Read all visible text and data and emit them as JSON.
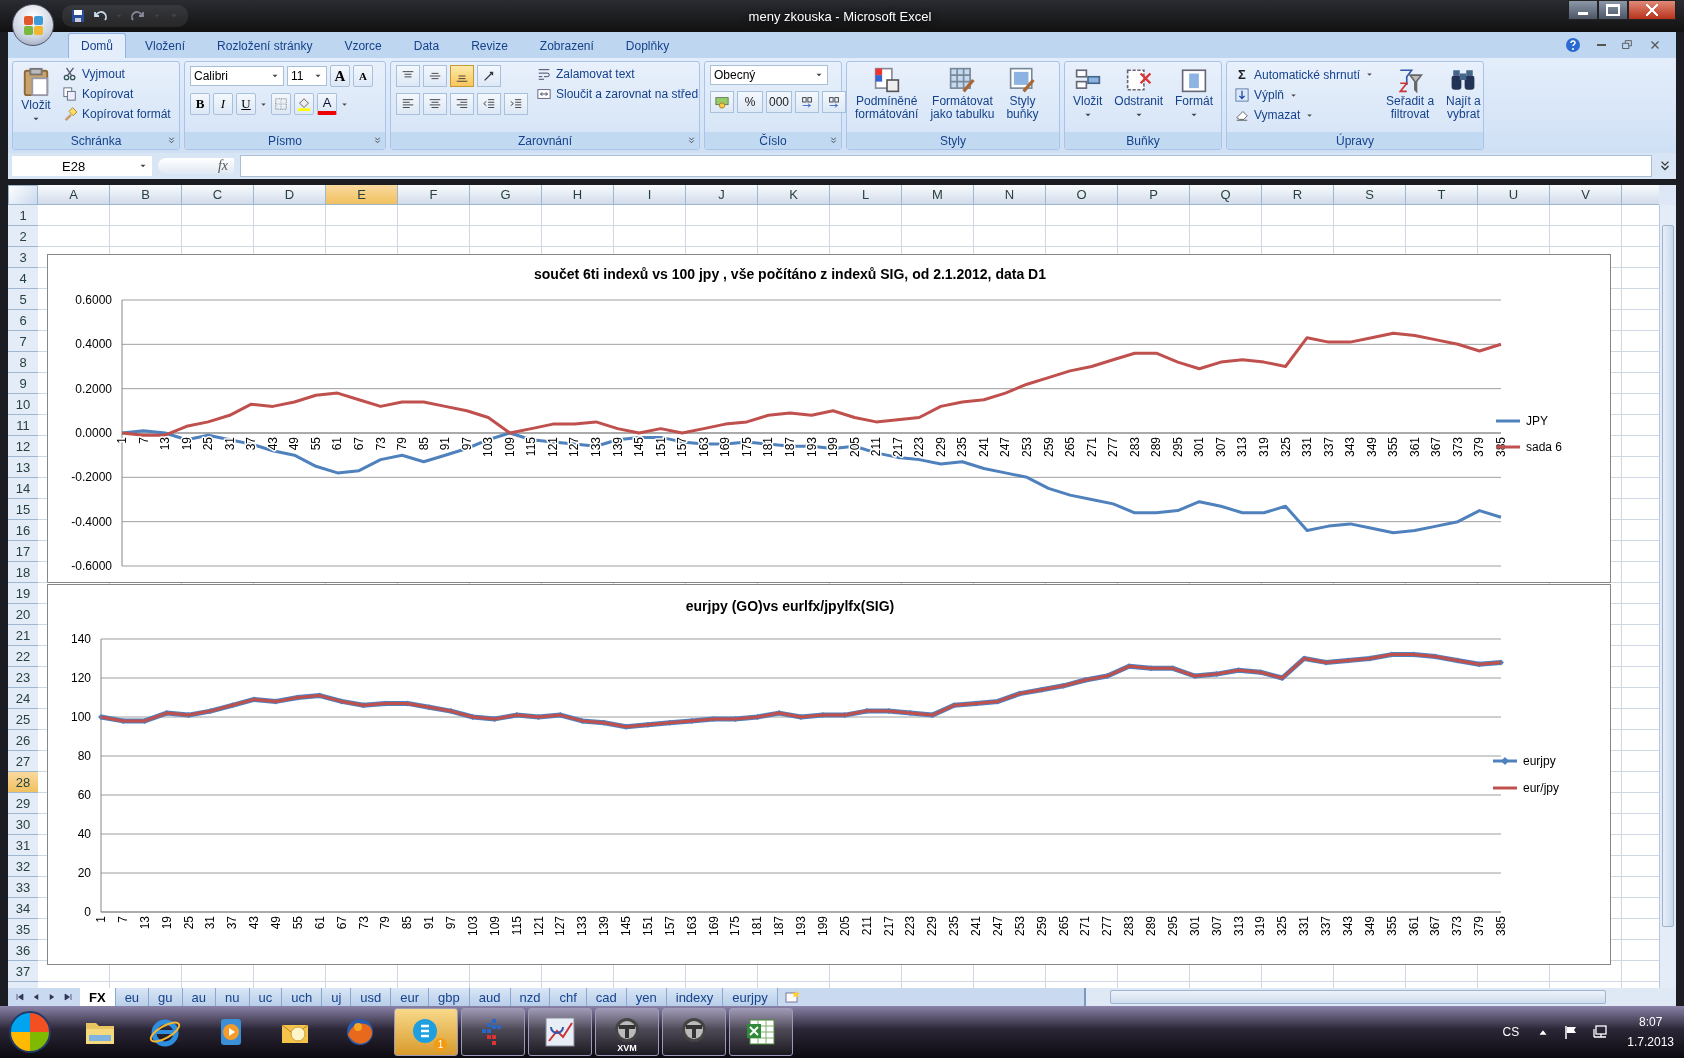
{
  "window": {
    "title": "meny zkouska  -  Microsoft Excel"
  },
  "ribbon_tabs": [
    {
      "label": "Domů",
      "selected": true
    },
    {
      "label": "Vložení",
      "selected": false
    },
    {
      "label": "Rozložení stránky",
      "selected": false
    },
    {
      "label": "Vzorce",
      "selected": false
    },
    {
      "label": "Data",
      "selected": false
    },
    {
      "label": "Revize",
      "selected": false
    },
    {
      "label": "Zobrazení",
      "selected": false
    },
    {
      "label": "Doplňky",
      "selected": false
    }
  ],
  "clipboard": {
    "label": "Schránka",
    "paste": "Vložit",
    "actions": [
      "Vyjmout",
      "Kopírovat",
      "Kopírovat formát"
    ]
  },
  "font": {
    "label": "Písmo",
    "name": "Calibri",
    "size": "11",
    "grow": "A",
    "shrink": "A",
    "styles": [
      "B",
      "I",
      "U"
    ],
    "color_button": "A"
  },
  "alignment": {
    "label": "Zarovnání",
    "vertical": [
      {
        "selected": false
      },
      {
        "selected": false
      },
      {
        "selected": true
      }
    ],
    "wrap": "Zalamovat text",
    "merge": "Sloučit a zarovnat na střed"
  },
  "number": {
    "label": "Číslo",
    "format": "Obecný",
    "percent": "%",
    "thousands": "000"
  },
  "styles": {
    "label": "Styly",
    "buttons": [
      "Podmíněné\nformátování",
      "Formátovat\njako tabulku",
      "Styly\nbuňky"
    ]
  },
  "cells": {
    "label": "Buňky",
    "buttons": [
      "Vložit",
      "Odstranit",
      "Formát"
    ]
  },
  "editing": {
    "label": "Úpravy",
    "sum_symbol": "Σ",
    "actions": [
      "Automatické shrnutí",
      "Výplň",
      "Vymazat"
    ],
    "buttons": [
      "Seřadit a\nfiltrovat",
      "Najít a\nvybrat"
    ]
  },
  "formula_bar": {
    "name_box": "E28",
    "fx": "fx"
  },
  "columns": [
    {
      "label": "A",
      "selected": false
    },
    {
      "label": "B",
      "selected": false
    },
    {
      "label": "C",
      "selected": false
    },
    {
      "label": "D",
      "selected": false
    },
    {
      "label": "E",
      "selected": true
    },
    {
      "label": "F",
      "selected": false
    },
    {
      "label": "G",
      "selected": false
    },
    {
      "label": "H",
      "selected": false
    },
    {
      "label": "I",
      "selected": false
    },
    {
      "label": "J",
      "selected": false
    },
    {
      "label": "K",
      "selected": false
    },
    {
      "label": "L",
      "selected": false
    },
    {
      "label": "M",
      "selected": false
    },
    {
      "label": "N",
      "selected": false
    },
    {
      "label": "O",
      "selected": false
    },
    {
      "label": "P",
      "selected": false
    },
    {
      "label": "Q",
      "selected": false
    },
    {
      "label": "R",
      "selected": false
    },
    {
      "label": "S",
      "selected": false
    },
    {
      "label": "T",
      "selected": false
    },
    {
      "label": "U",
      "selected": false
    },
    {
      "label": "V",
      "selected": false
    }
  ],
  "rows": [
    {
      "label": "1",
      "selected": false
    },
    {
      "label": "2",
      "selected": false
    },
    {
      "label": "3",
      "selected": false
    },
    {
      "label": "4",
      "selected": false
    },
    {
      "label": "5",
      "selected": false
    },
    {
      "label": "6",
      "selected": false
    },
    {
      "label": "7",
      "selected": false
    },
    {
      "label": "8",
      "selected": false
    },
    {
      "label": "9",
      "selected": false
    },
    {
      "label": "10",
      "selected": false
    },
    {
      "label": "11",
      "selected": false
    },
    {
      "label": "12",
      "selected": false
    },
    {
      "label": "13",
      "selected": false
    },
    {
      "label": "14",
      "selected": false
    },
    {
      "label": "15",
      "selected": false
    },
    {
      "label": "16",
      "selected": false
    },
    {
      "label": "17",
      "selected": false
    },
    {
      "label": "18",
      "selected": false
    },
    {
      "label": "19",
      "selected": false
    },
    {
      "label": "20",
      "selected": false
    },
    {
      "label": "21",
      "selected": false
    },
    {
      "label": "22",
      "selected": false
    },
    {
      "label": "23",
      "selected": false
    },
    {
      "label": "24",
      "selected": false
    },
    {
      "label": "25",
      "selected": false
    },
    {
      "label": "26",
      "selected": false
    },
    {
      "label": "27",
      "selected": false
    },
    {
      "label": "28",
      "selected": true
    },
    {
      "label": "29",
      "selected": false
    },
    {
      "label": "30",
      "selected": false
    },
    {
      "label": "31",
      "selected": false
    },
    {
      "label": "32",
      "selected": false
    },
    {
      "label": "33",
      "selected": false
    },
    {
      "label": "34",
      "selected": false
    },
    {
      "label": "35",
      "selected": false
    },
    {
      "label": "36",
      "selected": false
    },
    {
      "label": "37",
      "selected": false
    }
  ],
  "charts": [
    {
      "chart_data": {
        "type": "line",
        "grid": true,
        "legend": "right",
        "title": "součet 6ti indexů vs 100 jpy , vše počítáno z indexů SIG, od 2.1.2012, data D1",
        "categories": [
          "1",
          "7",
          "13",
          "19",
          "25",
          "31",
          "37",
          "43",
          "49",
          "55",
          "61",
          "67",
          "73",
          "79",
          "85",
          "91",
          "97",
          "103",
          "109",
          "115",
          "121",
          "127",
          "133",
          "139",
          "145",
          "151",
          "157",
          "163",
          "169",
          "175",
          "181",
          "187",
          "193",
          "199",
          "205",
          "211",
          "217",
          "223",
          "229",
          "235",
          "241",
          "247",
          "253",
          "259",
          "265",
          "271",
          "277",
          "283",
          "289",
          "295",
          "301",
          "307",
          "313",
          "319",
          "325",
          "331",
          "337",
          "343",
          "349",
          "355",
          "361",
          "367",
          "373",
          "379",
          "385"
        ],
        "ylim": [
          -0.6,
          0.6
        ],
        "yticks": [
          {
            "value": 0.6,
            "label": "0.6000"
          },
          {
            "value": 0.4,
            "label": "0.4000"
          },
          {
            "value": 0.2,
            "label": "0.2000"
          },
          {
            "value": 0,
            "label": "0.0000"
          },
          {
            "value": -0.2,
            "label": "-0.2000"
          },
          {
            "value": -0.4,
            "label": "-0.4000"
          },
          {
            "value": -0.6,
            "label": "-0.6000"
          }
        ],
        "series": [
          {
            "name": "JPY",
            "color": "#4f81bd",
            "values": [
              0,
              0.01,
              0,
              -0.03,
              -0.01,
              -0.03,
              -0.05,
              -0.08,
              -0.1,
              -0.15,
              -0.18,
              -0.17,
              -0.12,
              -0.1,
              -0.13,
              -0.1,
              -0.07,
              -0.03,
              0,
              -0.03,
              -0.04,
              -0.05,
              -0.06,
              -0.03,
              -0.02,
              -0.02,
              -0.04,
              -0.05,
              -0.05,
              -0.04,
              -0.05,
              -0.06,
              -0.06,
              -0.07,
              -0.06,
              -0.09,
              -0.11,
              -0.12,
              -0.14,
              -0.13,
              -0.16,
              -0.18,
              -0.2,
              -0.25,
              -0.28,
              -0.3,
              -0.32,
              -0.36,
              -0.36,
              -0.35,
              -0.31,
              -0.33,
              -0.36,
              -0.36,
              -0.33,
              -0.44,
              -0.42,
              -0.41,
              -0.43,
              -0.45,
              -0.44,
              -0.42,
              -0.4,
              -0.35,
              -0.38
            ]
          },
          {
            "name": "sada 6",
            "color": "#c0504d",
            "values": [
              0,
              -0.01,
              -0.01,
              0.03,
              0.05,
              0.08,
              0.13,
              0.12,
              0.14,
              0.17,
              0.18,
              0.15,
              0.12,
              0.14,
              0.14,
              0.12,
              0.1,
              0.07,
              0,
              0.02,
              0.04,
              0.04,
              0.05,
              0.02,
              0,
              0.02,
              0,
              0.02,
              0.04,
              0.05,
              0.08,
              0.09,
              0.08,
              0.1,
              0.07,
              0.05,
              0.06,
              0.07,
              0.12,
              0.14,
              0.15,
              0.18,
              0.22,
              0.25,
              0.28,
              0.3,
              0.33,
              0.36,
              0.36,
              0.32,
              0.29,
              0.32,
              0.33,
              0.32,
              0.3,
              0.43,
              0.41,
              0.41,
              0.43,
              0.45,
              0.44,
              0.42,
              0.4,
              0.37,
              0.4
            ]
          }
        ]
      }
    },
    {
      "chart_data": {
        "type": "line",
        "grid": true,
        "legend": "right",
        "title": "eurjpy (GO)vs eurlfx/jpylfx(SIG)",
        "categories": [
          "1",
          "7",
          "13",
          "19",
          "25",
          "31",
          "37",
          "43",
          "49",
          "55",
          "61",
          "67",
          "73",
          "79",
          "85",
          "91",
          "97",
          "103",
          "109",
          "115",
          "121",
          "127",
          "133",
          "139",
          "145",
          "151",
          "157",
          "163",
          "169",
          "175",
          "181",
          "187",
          "193",
          "199",
          "205",
          "211",
          "217",
          "223",
          "229",
          "235",
          "241",
          "247",
          "253",
          "259",
          "265",
          "271",
          "277",
          "283",
          "289",
          "295",
          "301",
          "307",
          "313",
          "319",
          "325",
          "331",
          "337",
          "343",
          "349",
          "355",
          "361",
          "367",
          "373",
          "379",
          "385"
        ],
        "ylim": [
          0,
          140
        ],
        "yticks": [
          0,
          20,
          40,
          60,
          80,
          100,
          120,
          140
        ],
        "series": [
          {
            "name": "eurjpy",
            "color": "#4f81bd",
            "marker": "diamond",
            "values": [
              100,
              98,
              98,
              102,
              101,
              103,
              106,
              109,
              108,
              110,
              111,
              108,
              106,
              107,
              107,
              105,
              103,
              100,
              99,
              101,
              100,
              101,
              98,
              97,
              95,
              96,
              97,
              98,
              99,
              99,
              100,
              102,
              100,
              101,
              101,
              103,
              103,
              102,
              101,
              106,
              107,
              108,
              112,
              114,
              116,
              119,
              121,
              126,
              125,
              125,
              121,
              122,
              124,
              123,
              120,
              130,
              128,
              129,
              130,
              132,
              132,
              131,
              129,
              127,
              128
            ]
          },
          {
            "name": "eur/jpy",
            "color": "#c0504d",
            "values": [
              100,
              98,
              98,
              102,
              101,
              103,
              106,
              109,
              108,
              110,
              111,
              108,
              106,
              107,
              107,
              105,
              103,
              100,
              99,
              101,
              100,
              101,
              98,
              97,
              95,
              96,
              97,
              98,
              99,
              99,
              100,
              102,
              100,
              101,
              101,
              103,
              103,
              102,
              101,
              106,
              107,
              108,
              112,
              114,
              116,
              119,
              121,
              126,
              125,
              125,
              121,
              122,
              124,
              123,
              120,
              130,
              128,
              129,
              130,
              132,
              132,
              131,
              129,
              127,
              128
            ]
          }
        ]
      }
    }
  ],
  "sheet_tabs": [
    {
      "label": "FX",
      "selected": true
    },
    {
      "label": "eu",
      "selected": false
    },
    {
      "label": "gu",
      "selected": false
    },
    {
      "label": "au",
      "selected": false
    },
    {
      "label": "nu",
      "selected": false
    },
    {
      "label": "uc",
      "selected": false
    },
    {
      "label": "uch",
      "selected": false
    },
    {
      "label": "uj",
      "selected": false
    },
    {
      "label": "usd",
      "selected": false
    },
    {
      "label": "eur",
      "selected": false
    },
    {
      "label": "gbp",
      "selected": false
    },
    {
      "label": "aud",
      "selected": false
    },
    {
      "label": "nzd",
      "selected": false
    },
    {
      "label": "chf",
      "selected": false
    },
    {
      "label": "cad",
      "selected": false
    },
    {
      "label": "yen",
      "selected": false
    },
    {
      "label": "indexy",
      "selected": false
    },
    {
      "label": "eurjpy",
      "selected": false
    }
  ],
  "taskbar": {
    "apps": [
      {
        "kind": "folder",
        "open": false
      },
      {
        "kind": "browser",
        "open": false
      },
      {
        "kind": "media",
        "open": false
      },
      {
        "kind": "mail",
        "open": false
      },
      {
        "kind": "globe",
        "open": false
      },
      {
        "kind": "chat",
        "open": true,
        "flashing": true,
        "badge": "1"
      },
      {
        "kind": "bars",
        "open": true,
        "flashing": false
      },
      {
        "kind": "sig",
        "open": true,
        "flashing": false
      },
      {
        "kind": "tank",
        "open": true,
        "flashing": false,
        "caption": "XVM"
      },
      {
        "kind": "tank",
        "open": true,
        "flashing": false
      },
      {
        "kind": "spreadsheet",
        "open": true,
        "flashing": false
      }
    ],
    "language": "CS",
    "time": "8:07",
    "date": "1.7.2013"
  }
}
